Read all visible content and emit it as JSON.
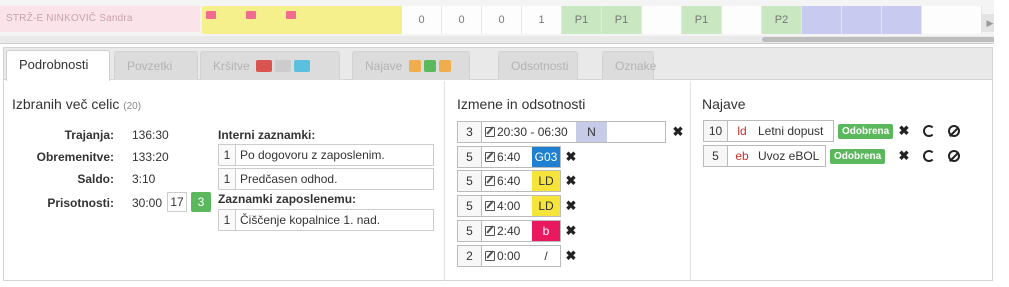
{
  "strip": {
    "name": "STRŽ-E NINKOVIČ Sandra",
    "cells": [
      "",
      "",
      "",
      "",
      "",
      "0",
      "0",
      "0",
      "1",
      "P1",
      "P1",
      "",
      "P1",
      "",
      "P2",
      "",
      "",
      "",
      ""
    ]
  },
  "tabs": [
    {
      "label": "Podrobnosti"
    },
    {
      "label": "Povzetki"
    },
    {
      "label": "Kršitve"
    },
    {
      "label": "Najave"
    },
    {
      "label": "Odsotnosti"
    },
    {
      "label": "Oznake"
    }
  ],
  "colors": {
    "red": "#d9534f",
    "gray": "#cccccc",
    "blue": "#5bc0de",
    "orange": "#f0ad4e",
    "green": "#5cb85c"
  },
  "left": {
    "title": "Izbranih več celic",
    "count": "(20)",
    "rows": [
      {
        "label": "Trajanja:",
        "value": "136:30"
      },
      {
        "label": "Obremenitve:",
        "value": "133:20"
      },
      {
        "label": "Saldo:",
        "value": "3:10"
      },
      {
        "label": "Prisotnosti:",
        "value": "30:00"
      }
    ],
    "presence_boxes": [
      "17",
      "3"
    ],
    "internal_title": "Interni zaznamki:",
    "internal_notes": [
      {
        "n": "1",
        "text": "Po dogovoru z zaposlenim."
      },
      {
        "n": "1",
        "text": "Predčasen odhod."
      }
    ],
    "employee_title": "Zaznamki zaposlenemu:",
    "employee_notes": [
      {
        "n": "1",
        "text": "Čiščenje kopalnice 1. nad."
      }
    ]
  },
  "middle": {
    "title": "Izmene in odsotnosti",
    "rows": [
      {
        "n": "3",
        "time": "20:30 - 06:30",
        "code": "N",
        "code_bg": "#c7cbe8",
        "code_fg": "#333333"
      },
      {
        "n": "5",
        "time": "6:40",
        "code": "G03",
        "code_bg": "#1f7fd1",
        "code_fg": "#ffffff"
      },
      {
        "n": "5",
        "time": "6:40",
        "code": "LD",
        "code_bg": "#f7e43a",
        "code_fg": "#333333"
      },
      {
        "n": "5",
        "time": "4:00",
        "code": "LD",
        "code_bg": "#f7e43a",
        "code_fg": "#333333"
      },
      {
        "n": "5",
        "time": "2:40",
        "code": "b",
        "code_bg": "#e8195f",
        "code_fg": "#ffffff"
      },
      {
        "n": "2",
        "time": "0:00",
        "code": "/",
        "code_bg": "#ffffff",
        "code_fg": "#333333"
      }
    ]
  },
  "right": {
    "title": "Najave",
    "rows": [
      {
        "n": "10",
        "code": "ld",
        "label": "Letni dopust",
        "status": "Odobrena"
      },
      {
        "n": "5",
        "code": "eb",
        "label": "Uvoz eBOL",
        "status": "Odobrena"
      }
    ]
  }
}
